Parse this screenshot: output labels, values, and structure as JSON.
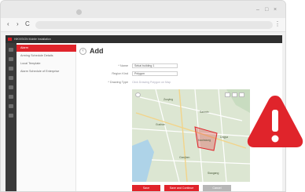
{
  "browser": {
    "back": "‹",
    "forward": "›",
    "reload": "C",
    "menu": "⋮",
    "window_controls": [
      "–",
      "□",
      "×"
    ]
  },
  "app": {
    "title": "HIKVISION Mobile Installation",
    "menu": [
      "Alarm",
      "Arming Schedule Details",
      "Local Template",
      "Alarm Schedule of Enterprise"
    ]
  },
  "form": {
    "page_title": "Add",
    "name_label": "* Name",
    "name_value": "Sekai building 1",
    "type_label": "Region Kind",
    "type_value": "Polygon",
    "draw_label": "* Drawing Type",
    "draw_hint": "Click Drawing Polygon on Map"
  },
  "map": {
    "labels": [
      "Kaohsiung",
      "Lingya",
      "Sanmin",
      "Gushan",
      "Cianjhen",
      "Siaogang",
      "Zuoying"
    ]
  },
  "buttons": {
    "save": "Save",
    "save_continue": "Save and Continue",
    "cancel": "Cancel"
  },
  "colors": {
    "brand": "#e0242b",
    "warning": "#e0242b"
  },
  "icons": {
    "warning": "warning-icon"
  }
}
